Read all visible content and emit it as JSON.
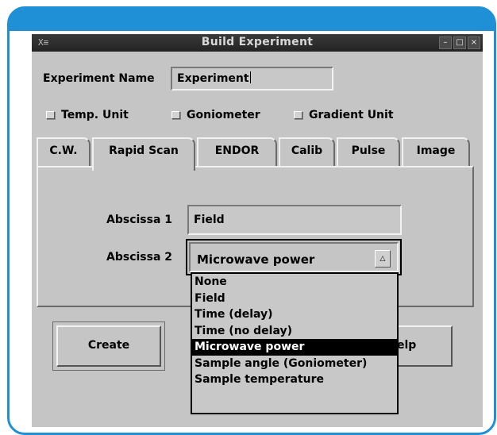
{
  "window": {
    "title": "Build Experiment",
    "system_icon": "X≡",
    "controls": {
      "minimize": "–",
      "maximize": "□",
      "close": "×"
    }
  },
  "experiment_name": {
    "label": "Experiment Name",
    "value": "Experiment"
  },
  "units": [
    {
      "label": "Temp. Unit",
      "checked": false
    },
    {
      "label": "Goniometer",
      "checked": false
    },
    {
      "label": "Gradient Unit",
      "checked": false
    }
  ],
  "tabs": [
    {
      "label": "C.W."
    },
    {
      "label": "Rapid Scan",
      "active": true
    },
    {
      "label": "ENDOR"
    },
    {
      "label": "Calib"
    },
    {
      "label": "Pulse"
    },
    {
      "label": "Image"
    }
  ],
  "rapid_scan": {
    "abscissa1": {
      "label": "Abscissa 1",
      "value": "Field"
    },
    "abscissa2": {
      "label": "Abscissa 2",
      "value": "Microwave power",
      "button_icon": "△"
    }
  },
  "dropdown": {
    "options": [
      "None",
      "Field",
      "Time (delay)",
      "Time (no delay)",
      "Microwave power",
      "Sample angle (Goniometer)",
      "Sample temperature"
    ],
    "selected": "Microwave power"
  },
  "buttons": {
    "create": "Create",
    "help_visible": "elp"
  },
  "colors": {
    "frame": "#1f8fd6",
    "window_bg": "#c5c5c5",
    "titlebar": "#2b2b2b"
  }
}
